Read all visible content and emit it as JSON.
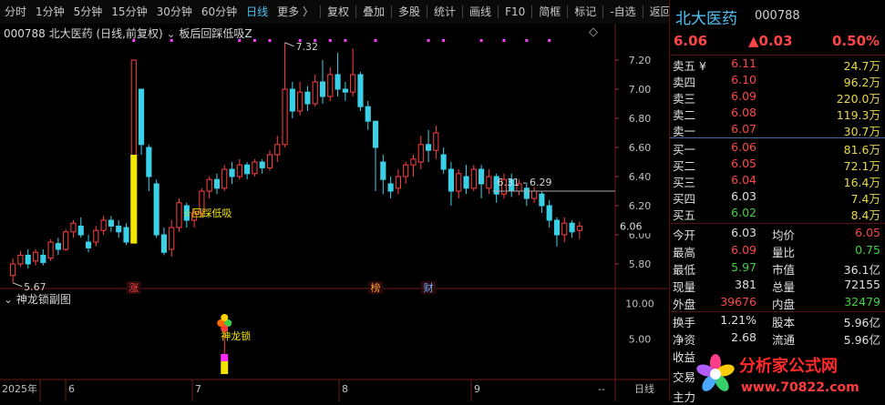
{
  "toolbar": {
    "left": [
      "分时",
      "1分钟",
      "5分钟",
      "15分钟",
      "30分钟",
      "60分钟",
      "日线",
      "更多 〉"
    ],
    "right": [
      "复权",
      "叠加",
      "多股",
      "统计",
      "画线",
      "F10",
      "简框",
      "标记",
      "-自选",
      "返回"
    ]
  },
  "chart": {
    "code": "000788",
    "name": "北大医药",
    "mode": "(日线,前复权)",
    "indicator": "板后回踩低吸Z",
    "subchart_title": "神龙锁副图",
    "high_mark": "7.32",
    "low_mark": "5.67",
    "range_label": "6.31 - 6.29",
    "current_tag": "6.06",
    "signal_label": "回踩低吸",
    "sub_signal_label": "神龙锁",
    "y_ticks": [
      "7.20",
      "7.00",
      "6.80",
      "6.60",
      "6.40",
      "6.20",
      "6.00",
      "5.80"
    ],
    "sub_y_ticks": [
      "10.00",
      "5.00"
    ],
    "x_labels": [
      "2025年",
      "6",
      "7",
      "8",
      "9"
    ],
    "bottom_right": "日线",
    "bottom_dash": "--",
    "badges": [
      {
        "text": "涨",
        "color": "#ff4545"
      },
      {
        "text": "榜",
        "color": "#ff9a3c"
      },
      {
        "text": "财",
        "color": "#6fb0ff"
      }
    ],
    "diamond": "◇"
  },
  "panel": {
    "name": "北大医药",
    "code": "000788",
    "price": "6.06",
    "change": "▲0.03",
    "pct": "0.50%",
    "asks": [
      {
        "label": "卖五 ¥",
        "price": "6.11",
        "vol": "24.7万"
      },
      {
        "label": "卖四",
        "price": "6.10",
        "vol": "96.2万"
      },
      {
        "label": "卖三",
        "price": "6.09",
        "vol": "220.0万"
      },
      {
        "label": "卖二",
        "price": "6.08",
        "vol": "119.3万"
      },
      {
        "label": "卖一",
        "price": "6.07",
        "vol": "30.7万"
      }
    ],
    "bids": [
      {
        "label": "买一",
        "price": "6.06",
        "vol": "81.6万",
        "pcolor": "red"
      },
      {
        "label": "买二",
        "price": "6.05",
        "vol": "72.1万",
        "pcolor": "red"
      },
      {
        "label": "买三",
        "price": "6.04",
        "vol": "16.4万",
        "pcolor": "red"
      },
      {
        "label": "买四",
        "price": "6.03",
        "vol": "7.4万",
        "pcolor": "white"
      },
      {
        "label": "买五",
        "price": "6.02",
        "vol": "8.4万",
        "pcolor": "green"
      }
    ],
    "stats": [
      {
        "l1": "今开",
        "v1": "6.03",
        "c1": "white",
        "l2": "均价",
        "v2": "6.05",
        "c2": "red"
      },
      {
        "l1": "最高",
        "v1": "6.09",
        "c1": "red",
        "l2": "量比",
        "v2": "0.75",
        "c2": "green"
      },
      {
        "l1": "最低",
        "v1": "5.97",
        "c1": "green",
        "l2": "市值",
        "v2": "36.1亿",
        "c2": "white"
      },
      {
        "l1": "现量",
        "v1": "381",
        "c1": "white",
        "l2": "总量",
        "v2": "72155",
        "c2": "white"
      },
      {
        "l1": "外盘",
        "v1": "39676",
        "c1": "red",
        "l2": "内盘",
        "v2": "32479",
        "c2": "green"
      }
    ],
    "stats2": [
      {
        "l1": "换手",
        "v1": "1.21%",
        "l2": "股本",
        "v2": "5.96亿"
      },
      {
        "l1": "净资",
        "v1": "2.68",
        "l2": "流通",
        "v2": "5.96亿"
      }
    ],
    "tail": [
      "收益",
      "交易",
      "主力"
    ]
  },
  "watermark": {
    "name": "分析家公式网",
    "url": "www.70822.com"
  },
  "chart_data": {
    "type": "candlestick",
    "ylim": [
      5.7,
      7.35
    ],
    "candles": [
      [
        5.72,
        5.8,
        5.67,
        5.84
      ],
      [
        5.8,
        5.86,
        5.78,
        5.89
      ],
      [
        5.86,
        5.8,
        5.77,
        5.9
      ],
      [
        5.82,
        5.88,
        5.79,
        5.9
      ],
      [
        5.86,
        5.81,
        5.79,
        5.9
      ],
      [
        5.84,
        5.95,
        5.82,
        5.97
      ],
      [
        5.94,
        5.9,
        5.86,
        5.98
      ],
      [
        5.9,
        6.02,
        5.89,
        6.04
      ],
      [
        6.02,
        6.08,
        5.98,
        6.1
      ],
      [
        6.06,
        6.0,
        5.98,
        6.12
      ],
      [
        5.95,
        5.91,
        5.88,
        6.0
      ],
      [
        5.95,
        6.03,
        5.92,
        6.06
      ],
      [
        6.03,
        6.1,
        6.0,
        6.13
      ],
      [
        6.1,
        6.06,
        6.02,
        6.13
      ],
      [
        6.06,
        6.02,
        5.98,
        6.1
      ],
      [
        6.05,
        5.95,
        5.93,
        6.08
      ],
      [
        5.96,
        7.2,
        5.96,
        7.2
      ],
      [
        7.0,
        6.62,
        6.55,
        7.0
      ],
      [
        6.6,
        6.4,
        6.3,
        6.62
      ],
      [
        6.35,
        6.0,
        5.98,
        6.38
      ],
      [
        6.0,
        5.88,
        5.86,
        6.05
      ],
      [
        5.9,
        6.05,
        5.85,
        6.1
      ],
      [
        6.05,
        6.22,
        6.02,
        6.25
      ],
      [
        6.2,
        6.1,
        6.05,
        6.22
      ],
      [
        6.1,
        6.15,
        6.05,
        6.18
      ],
      [
        6.15,
        6.3,
        6.12,
        6.32
      ],
      [
        6.3,
        6.38,
        6.25,
        6.4
      ],
      [
        6.38,
        6.32,
        6.28,
        6.42
      ],
      [
        6.32,
        6.45,
        6.3,
        6.48
      ],
      [
        6.45,
        6.4,
        6.35,
        6.5
      ],
      [
        6.4,
        6.48,
        6.38,
        6.52
      ],
      [
        6.48,
        6.42,
        6.38,
        6.5
      ],
      [
        6.42,
        6.5,
        6.4,
        6.52
      ],
      [
        6.5,
        6.46,
        6.42,
        6.52
      ],
      [
        6.46,
        6.55,
        6.44,
        6.58
      ],
      [
        6.55,
        6.62,
        6.5,
        6.68
      ],
      [
        6.62,
        7.0,
        6.6,
        7.32
      ],
      [
        7.0,
        6.85,
        6.8,
        7.05
      ],
      [
        6.85,
        6.98,
        6.82,
        7.05
      ],
      [
        6.98,
        6.9,
        6.85,
        7.02
      ],
      [
        6.9,
        7.05,
        6.88,
        7.1
      ],
      [
        7.05,
        6.95,
        6.9,
        7.2
      ],
      [
        6.95,
        7.1,
        6.92,
        7.15
      ],
      [
        7.1,
        7.0,
        6.95,
        7.25
      ],
      [
        7.0,
        6.98,
        6.92,
        7.05
      ],
      [
        6.98,
        7.1,
        6.95,
        7.28
      ],
      [
        7.1,
        6.88,
        6.85,
        7.12
      ],
      [
        6.88,
        6.78,
        6.72,
        6.92
      ],
      [
        6.78,
        6.6,
        6.3,
        6.68
      ],
      [
        6.5,
        6.38,
        6.28,
        6.55
      ],
      [
        6.35,
        6.3,
        6.25,
        6.4
      ],
      [
        6.32,
        6.4,
        6.28,
        6.45
      ],
      [
        6.4,
        6.48,
        6.35,
        6.5
      ],
      [
        6.48,
        6.52,
        6.4,
        6.55
      ],
      [
        6.5,
        6.62,
        6.45,
        6.68
      ],
      [
        6.62,
        6.58,
        6.5,
        6.72
      ],
      [
        6.58,
        6.7,
        6.52,
        6.75
      ],
      [
        6.55,
        6.45,
        6.42,
        6.6
      ],
      [
        6.45,
        6.3,
        6.2,
        6.5
      ],
      [
        6.3,
        6.42,
        6.25,
        6.45
      ],
      [
        6.4,
        6.32,
        6.28,
        6.48
      ],
      [
        6.32,
        6.45,
        6.3,
        6.48
      ],
      [
        6.45,
        6.35,
        6.25,
        6.48
      ],
      [
        6.32,
        6.4,
        6.28,
        6.45
      ],
      [
        6.4,
        6.28,
        6.22,
        6.42
      ],
      [
        6.28,
        6.38,
        6.25,
        6.42
      ],
      [
        6.38,
        6.3,
        6.26,
        6.42
      ],
      [
        6.3,
        6.35,
        6.27,
        6.38
      ],
      [
        6.32,
        6.25,
        6.2,
        6.36
      ],
      [
        6.25,
        6.3,
        6.22,
        6.33
      ],
      [
        6.28,
        6.2,
        6.15,
        6.3
      ],
      [
        6.2,
        6.1,
        6.05,
        6.24
      ],
      [
        6.1,
        6.0,
        5.92,
        6.12
      ],
      [
        6.0,
        6.08,
        5.95,
        6.12
      ],
      [
        6.08,
        6.02,
        5.98,
        6.1
      ],
      [
        6.03,
        6.06,
        5.97,
        6.09
      ]
    ],
    "sub_values": [
      0,
      0,
      0,
      0,
      0,
      0,
      0,
      0,
      0,
      0,
      0,
      0,
      0,
      0,
      0,
      0,
      0,
      0,
      0,
      0,
      0,
      0,
      0,
      0,
      0,
      0,
      0,
      0,
      0,
      0,
      0,
      0,
      0,
      0,
      0,
      0,
      0,
      0,
      0,
      0
    ],
    "sub_ylim": [
      0,
      11
    ]
  }
}
